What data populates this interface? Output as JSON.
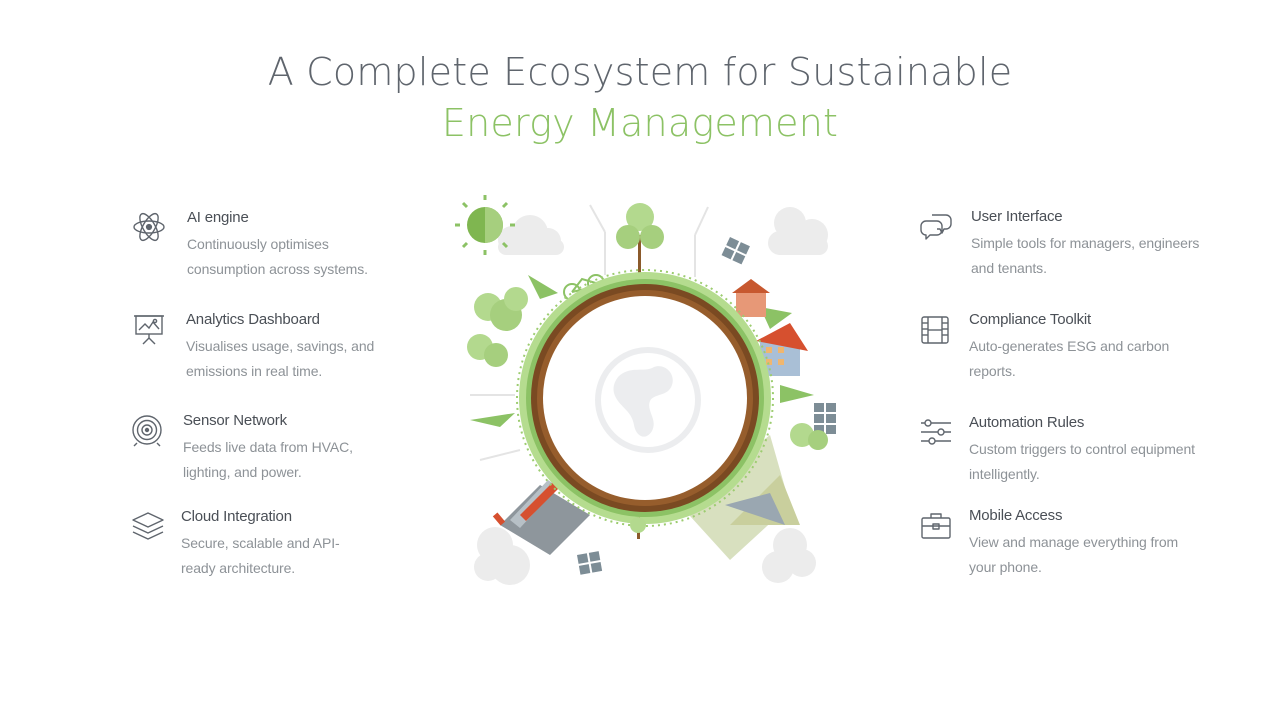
{
  "slide": {
    "title_line1": "A Complete Ecosystem for Sustainable",
    "title_line2": "Energy Management"
  },
  "left_features": [
    {
      "icon": "atom-icon",
      "title": "AI engine",
      "desc_line1": "Continuously optimises",
      "desc_line2": "consumption across systems."
    },
    {
      "icon": "presentation-board-icon",
      "title": "Analytics Dashboard",
      "desc_line1": "Visualises usage, savings, and",
      "desc_line2": "emissions in real time."
    },
    {
      "icon": "target-icon",
      "title": "Sensor Network",
      "desc_line1": "Feeds live data from HVAC,",
      "desc_line2": "lighting, and power."
    },
    {
      "icon": "layers-icon",
      "title": "Cloud Integration",
      "desc_line1": "Secure, scalable and API-",
      "desc_line2": "ready architecture."
    }
  ],
  "right_features": [
    {
      "icon": "chat-bubbles-icon",
      "title": "User Interface",
      "desc_line1": "Simple tools for managers, engineers",
      "desc_line2": "and tenants."
    },
    {
      "icon": "film-strip-icon",
      "title": "Compliance Toolkit",
      "desc_line1": "Auto-generates ESG and carbon",
      "desc_line2": "reports."
    },
    {
      "icon": "sliders-icon",
      "title": "Automation Rules",
      "desc_line1": "Custom triggers to control equipment",
      "desc_line2": "intelligently."
    },
    {
      "icon": "briefcase-icon",
      "title": "Mobile Access",
      "desc_line1": "View and manage everything from",
      "desc_line2": "your phone."
    }
  ],
  "colors": {
    "title_primary": "#5f656d",
    "title_accent": "#8cc265",
    "heading": "#4a4f56",
    "body": "#8d9297",
    "ring_brown": "#7a4a22",
    "ring_green": "#a6cf7e"
  },
  "illustration": "eco-globe-illustration"
}
